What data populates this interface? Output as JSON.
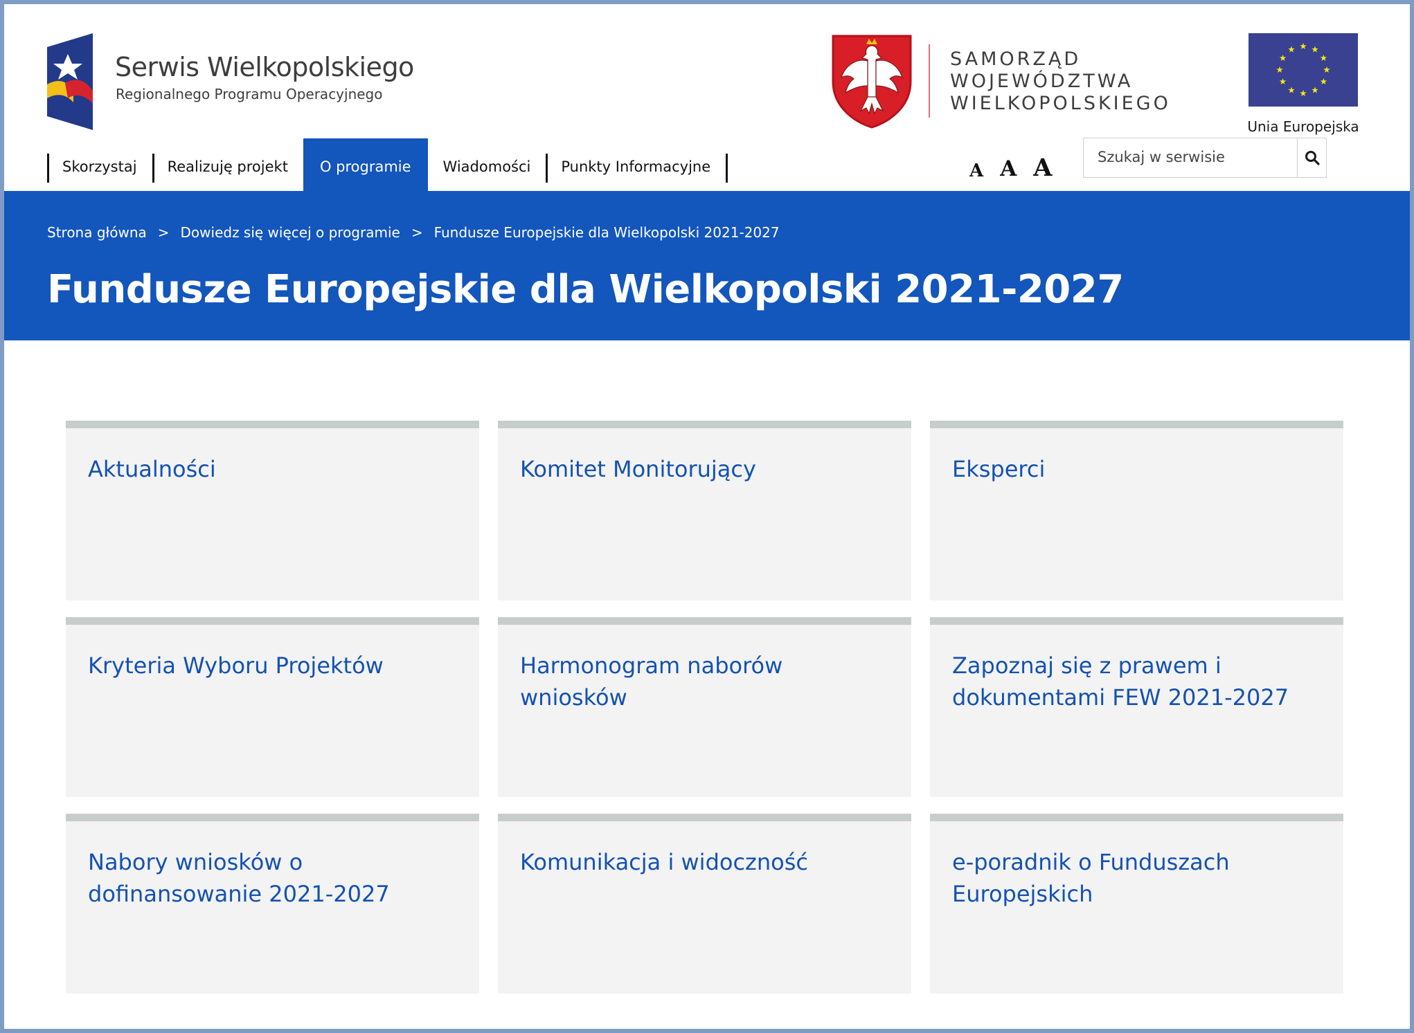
{
  "header": {
    "logo_title": "Serwis Wielkopolskiego",
    "logo_subtitle": "Regionalnego Programu Operacyjnego",
    "samorzad_lines": [
      "SAMORZĄD",
      "WOJEWÓDZTWA",
      "WIELKOPOLSKIEGO"
    ],
    "eu_label": "Unia Europejska"
  },
  "nav": {
    "items": [
      {
        "label": "Skorzystaj"
      },
      {
        "label": "Realizuję projekt"
      },
      {
        "label": "O programie"
      },
      {
        "label": "Wiadomości"
      },
      {
        "label": "Punkty Informacyjne"
      }
    ],
    "active": "O programie"
  },
  "font_sizes": [
    "A",
    "A",
    "A"
  ],
  "search": {
    "placeholder": "Szukaj w serwisie"
  },
  "breadcrumb": {
    "items": [
      "Strona główna",
      "Dowiedz się więcej o programie",
      "Fundusze Europejskie dla Wielkopolski 2021-2027"
    ],
    "separator": ">"
  },
  "page_title": "Fundusze Europejskie dla Wielkopolski 2021-2027",
  "tiles": [
    {
      "label": "Aktualności"
    },
    {
      "label": "Komitet Monitorujący"
    },
    {
      "label": "Eksperci"
    },
    {
      "label": "Kryteria Wyboru Projektów"
    },
    {
      "label": "Harmonogram naborów wniosków"
    },
    {
      "label": "Zapoznaj się z prawem i dokumentami FEW 2021-2027"
    },
    {
      "label": "Nabory wniosków o dofinansowanie 2021-2027"
    },
    {
      "label": "Komunikacja i widoczność"
    },
    {
      "label": "e-poradnik o Funduszach Europejskich"
    }
  ],
  "colors": {
    "primary": "#1356bc",
    "tile_label": "#1452b1",
    "tile_bg": "#f3f3f3",
    "tile_border": "#c7cdcb"
  }
}
